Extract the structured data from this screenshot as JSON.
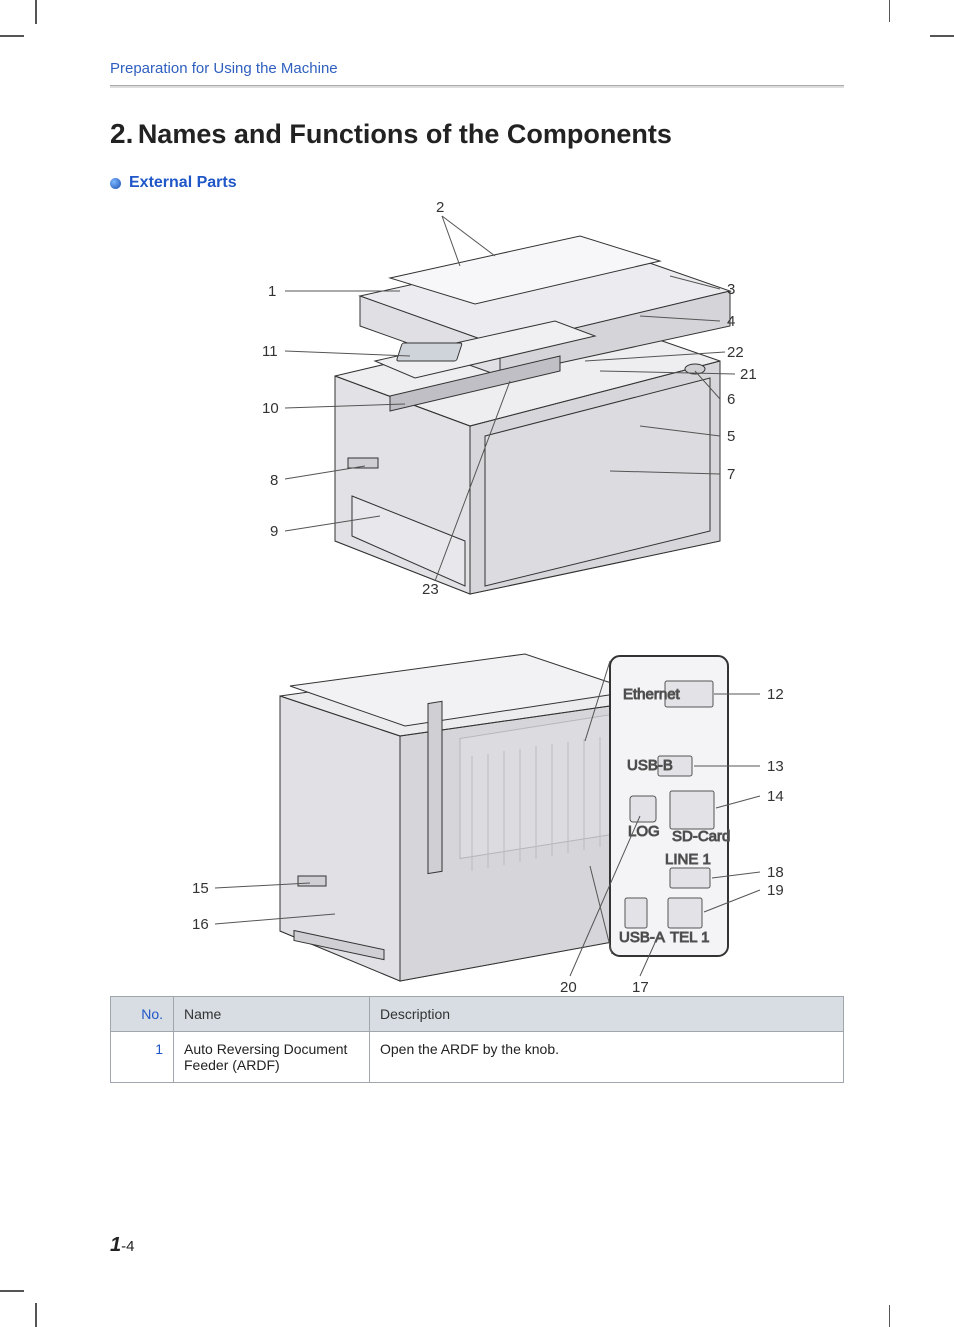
{
  "running_head": "Preparation for Using the Machine",
  "section": {
    "number": "2.",
    "title": "Names and Functions of the Components"
  },
  "subsection": {
    "title": "External Parts"
  },
  "callouts": {
    "top": {
      "left": [
        "1",
        "11",
        "10",
        "8",
        "9"
      ],
      "top": [
        "2"
      ],
      "right": [
        "3",
        "4",
        "22",
        "21",
        "6",
        "5",
        "7"
      ],
      "bottom": [
        "23"
      ]
    },
    "bottom": {
      "left": [
        "15",
        "16"
      ],
      "right": [
        "12",
        "13",
        "14",
        "18",
        "19"
      ],
      "bottom": [
        "20",
        "17"
      ]
    }
  },
  "port_labels": {
    "ethernet": "Ethernet",
    "usb_b": "USB-B",
    "log": "LOG",
    "sd": "SD-Card",
    "line1": "LINE 1",
    "usb_a": "USB-A",
    "tel1": "TEL 1"
  },
  "table": {
    "headers": {
      "no": "No.",
      "name": "Name",
      "desc": "Description"
    },
    "rows": [
      {
        "no": "1",
        "name": "Auto Reversing Document Feeder (ARDF)",
        "desc": "Open the ARDF by the knob."
      }
    ]
  },
  "page_number": {
    "chapter": "1",
    "page": "-4"
  },
  "chart_data": null
}
